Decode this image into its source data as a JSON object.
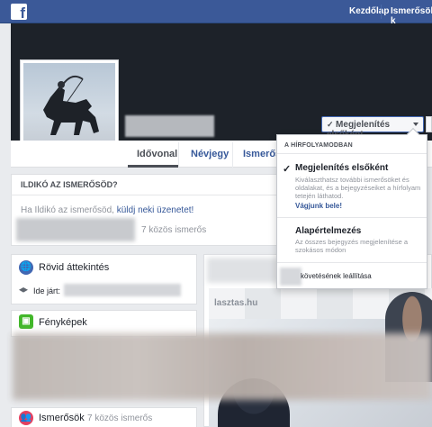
{
  "topbar": {
    "logo": "f",
    "nav": [
      "Kezdőlap",
      "Ismerősök k"
    ]
  },
  "profile": {
    "follow_button": "Megjelenítés elsőként"
  },
  "tabs": [
    "Idővonal",
    "Névjegy",
    "Ismerős"
  ],
  "know_card": {
    "title": "ILDIKÓ AZ ISMERŐSÖD?",
    "text_prefix": "Ha Ildikó az ismerősöd, ",
    "link": "küldj neki üzenetet!",
    "mutual": "7 közös ismerős"
  },
  "left_cards": {
    "intro_title": "Rövid áttekintés",
    "intro_edu": "Ide járt:",
    "photos_title": "Fényképek",
    "friends_title": "Ismerősök",
    "friends_count": "7 közös ismerős"
  },
  "feed": {
    "banner_text": "lasztas.hu"
  },
  "dropdown": {
    "header": "A HÍRFOLYAMODBAN",
    "check": "✓",
    "option1_title": "Megjelenítés elsőként",
    "option1_desc": "Kiválaszthatsz további ismerősöket és oldalakat, és a bejegyzéseiket a hírfolyam tetején láthatod.",
    "option1_link": "Vágjunk bele!",
    "option2_title": "Alapértelmezés",
    "option2_desc": "Az összes bejegyzés megjelenítése a szokásos módon",
    "unfollow": "követésének leállítása"
  },
  "colors": {
    "topbar": "#3b5998",
    "link": "#365899",
    "background": "#e9ebee"
  }
}
